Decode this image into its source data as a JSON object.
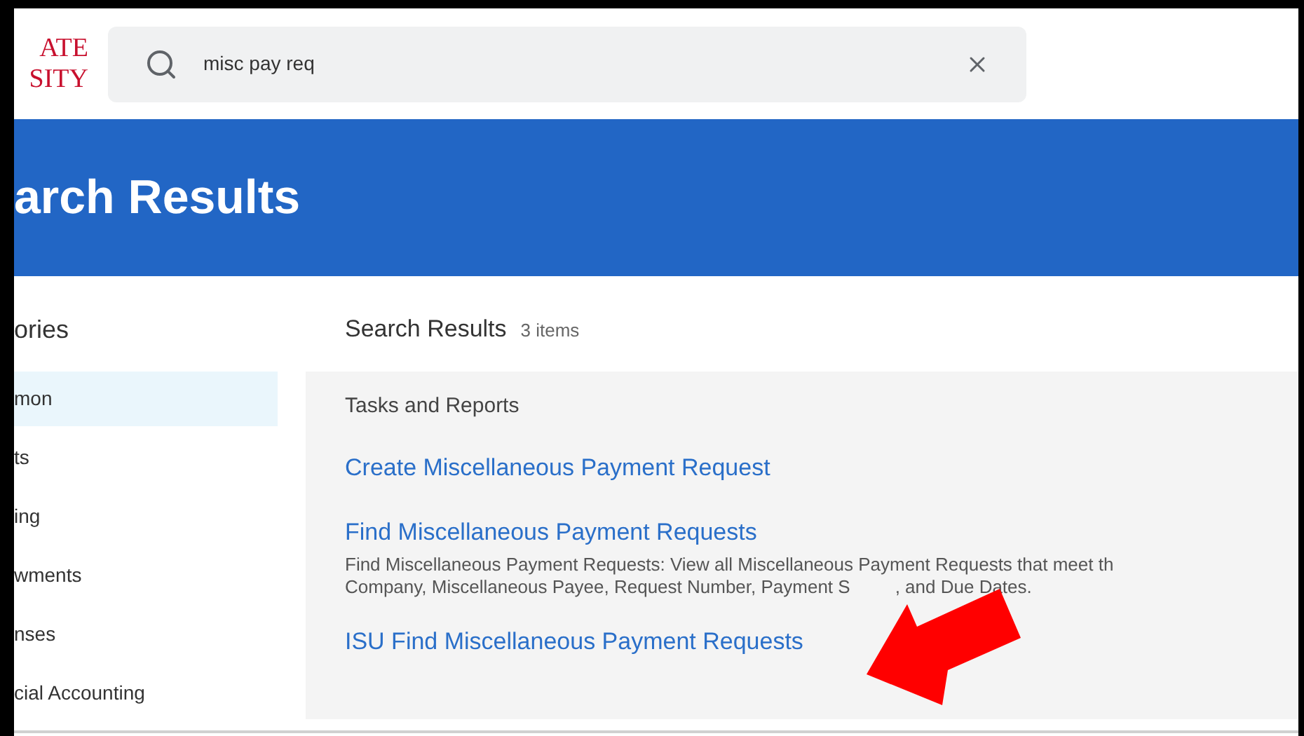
{
  "logo": {
    "lines": [
      "ATE",
      "SITY"
    ]
  },
  "search": {
    "value": "misc pay req"
  },
  "page_title": "arch Results",
  "sidebar": {
    "heading": "ories",
    "items": [
      {
        "label": "mon",
        "selected": true
      },
      {
        "label": "ts",
        "selected": false
      },
      {
        "label": "ing",
        "selected": false
      },
      {
        "label": "wments",
        "selected": false
      },
      {
        "label": "nses",
        "selected": false
      },
      {
        "label": "cial Accounting",
        "selected": false
      }
    ]
  },
  "results": {
    "heading": "Search Results",
    "count": "3 items",
    "group": "Tasks and Reports",
    "items": [
      {
        "title": "Create Miscellaneous Payment Request"
      },
      {
        "title": "Find Miscellaneous Payment Requests",
        "description": [
          "Find Miscellaneous Payment Requests: View all Miscellaneous Payment Requests that meet th",
          "Company, Miscellaneous Payee, Request Number, Payment S",
          ", and Due Dates."
        ]
      },
      {
        "title": "ISU Find Miscellaneous Payment Requests"
      }
    ]
  }
}
